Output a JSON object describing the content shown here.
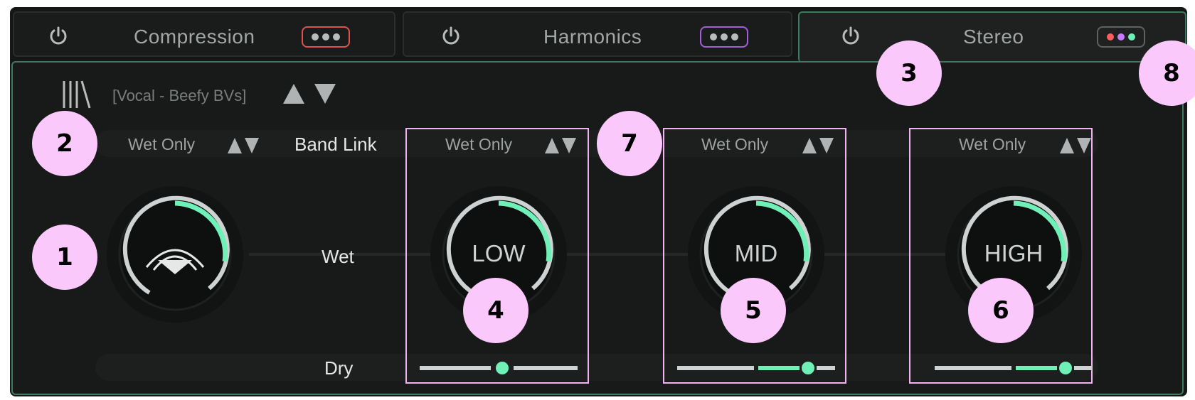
{
  "tabs": [
    {
      "label": "Compression",
      "dots_color": "#e0524f"
    },
    {
      "label": "Harmonics",
      "dots_color": "#a35fd9"
    },
    {
      "label": "Stereo",
      "dots_colors": [
        "#ff5c5c",
        "#c978ff",
        "#6ef0b6"
      ]
    }
  ],
  "preset": {
    "name": "[Vocal - Beefy BVs]"
  },
  "controls": {
    "wet_only": "Wet Only",
    "band_link": "Band Link",
    "wet": "Wet",
    "dry": "Dry"
  },
  "bands": [
    {
      "label": "LOW",
      "mode": "Wet Only",
      "knob_value": 0.3,
      "slider_value": 0.5
    },
    {
      "label": "MID",
      "mode": "Wet Only",
      "knob_value": 0.3,
      "slider_value": 0.8
    },
    {
      "label": "HIGH",
      "mode": "Wet Only",
      "knob_value": 0.3,
      "slider_value": 0.8
    }
  ],
  "main_knob": {
    "value": 0.3
  },
  "callouts": [
    "1",
    "2",
    "3",
    "4",
    "5",
    "6",
    "7",
    "8"
  ],
  "colors": {
    "accent": "#6ef0b6",
    "callout": "#fbc8fb",
    "band_outline": "#f2b3f2"
  }
}
